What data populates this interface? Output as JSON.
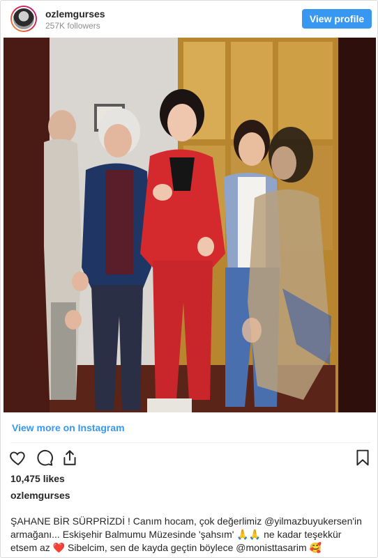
{
  "header": {
    "username": "ozlemgurses",
    "followers": "257K followers",
    "view_profile_label": "View profile"
  },
  "post": {
    "view_more_label": "View more on Instagram",
    "likes": "10,475 likes",
    "caption_user": "ozlemgurses",
    "caption": {
      "part1": "ŞAHANE BİR SÜRPRİZDİ ! Canım hocam, çok değerlimiz ",
      "mention1": "@yilmazbuyukersen",
      "part2": "'in armağanı... Eskişehir Balmumu Müzesinde 'şahsım' 🙏🙏 ne kadar teşekkür etsem az ❤️ Sibelcim, sen de kayda geçtin böylece ",
      "mention2": "@monisttasarim",
      "part3": " 🥰"
    }
  },
  "icons": [
    "heart-icon",
    "comment-icon",
    "share-icon",
    "bookmark-icon"
  ],
  "colors": {
    "accent": "#3897f0",
    "text": "#262626",
    "muted": "#8e8e8e"
  }
}
